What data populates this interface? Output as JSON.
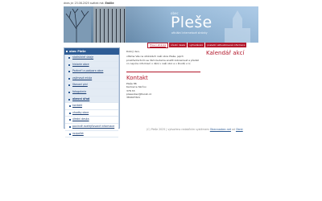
{
  "topbar": {
    "date_text": "dnes je: 23.08.2025 svátek má:",
    "nameday": "Emilie"
  },
  "banner": {
    "small": "obec",
    "title": "Pleše",
    "subtitle": "oficiální internetové stránky"
  },
  "tabs": [
    {
      "label": "Hlavní stránka",
      "active": true
    },
    {
      "label": "úřední deska",
      "active": false
    },
    {
      "label": "vyhledávání",
      "active": false
    },
    {
      "label": "poslední aktualizované informace",
      "active": false
    }
  ],
  "sidebar": {
    "header": "obec Pleše",
    "items": [
      {
        "label": "statistické údaje",
        "sub": false,
        "current": false
      },
      {
        "label": "historie obce",
        "sub": false,
        "current": false
      },
      {
        "label": "Partneři a podpora obce",
        "sub": false,
        "current": false
      },
      {
        "label": "zajímavá místa",
        "sub": false,
        "current": false
      },
      {
        "label": "Stavaní plní",
        "sub": false,
        "current": false
      },
      {
        "label": "fotogalerie",
        "sub": false,
        "current": false
      },
      {
        "label": "obecní úřad",
        "sub": false,
        "current": true
      },
      {
        "label": "kontakt",
        "sub": true,
        "current": false
      },
      {
        "label": "vhodky obce",
        "sub": true,
        "current": false
      },
      {
        "label": "úřední deska",
        "sub": true,
        "current": false
      },
      {
        "label": "povinně zveřejňované informace",
        "sub": true,
        "current": false
      },
      {
        "label": "rozpočet",
        "sub": true,
        "current": false
      }
    ]
  },
  "content": {
    "greeting": "Dobrý den,",
    "paragraph": "vítáme Vás na stránkách naší obce Pleše, jejich prostřednictvím se Vám budeme snažit zobrazovat a předat co nejvíce informací o dění v naší obci a v životě v ní.",
    "contact_title": "Kontakt",
    "contact_lines": [
      "Pleše 86",
      "Karlovice Skrčov",
      "378 33",
      "pleseobec@tiscali.cz",
      "384427621"
    ]
  },
  "calendar": {
    "title": "Kalendář akcí"
  },
  "footer": {
    "text": "(C) Pleše 2025 | vytvořeno redakčním systémem",
    "link1": "Obecnaobec.net",
    "sep": " od ",
    "link2": "Obrst"
  }
}
